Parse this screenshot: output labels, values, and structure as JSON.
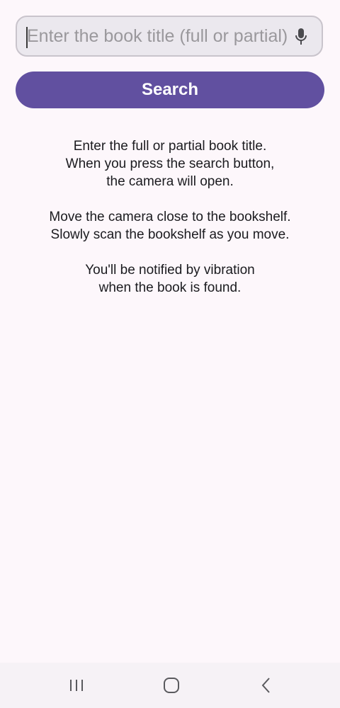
{
  "search": {
    "value": "",
    "placeholder": "Enter the book title (full or partial)",
    "mic_icon": "microphone-icon"
  },
  "search_button": {
    "label": "Search",
    "color": "#6150a0"
  },
  "instructions": [
    [
      "Enter the full or partial book title.",
      "When you press the search button,",
      "the camera will open."
    ],
    [
      "Move the camera close to the bookshelf.",
      "Slowly scan the bookshelf as you move."
    ],
    [
      "You'll be notified by vibration",
      "when the book is found."
    ]
  ],
  "nav_bar": {
    "recents_icon": "recent-apps-icon",
    "home_icon": "home-icon",
    "back_icon": "back-icon"
  }
}
